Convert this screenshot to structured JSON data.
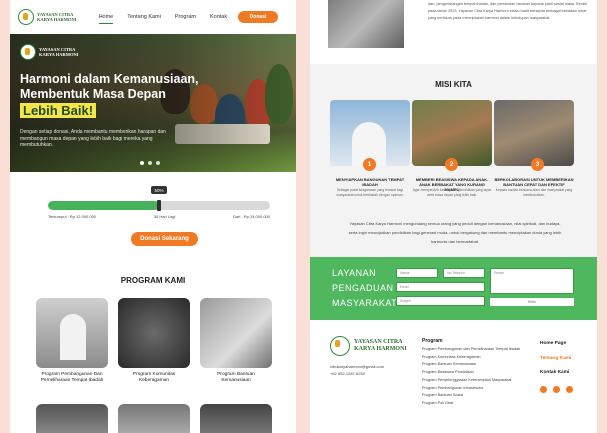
{
  "nav": {
    "logo_line1": "YAYASAN CITRA",
    "logo_line2": "KARYA HARMONI",
    "items": [
      "Home",
      "Tentang Kami",
      "Program",
      "Kontak"
    ],
    "donate_label": "Donasi"
  },
  "hero": {
    "logo_line1": "YAYASAN CITRA",
    "logo_line2": "KARYA HARMONI",
    "title_line1": "Harmoni dalam Kemanusiaan,",
    "title_line2": "Membentuk Masa Depan",
    "highlight": "Lebih Baik!",
    "description": "Dengan setiap donasi, Anda membantu memberikan harapan dan membangun masa depan yang lebih baik bagi mereka yang membutuhkan.",
    "slides": 3,
    "active_slide": 0
  },
  "progress": {
    "percent_label": "50%",
    "fraction": 0.5,
    "collected": "Terkumpul : Rp 12.000.000",
    "days_left": "30 Hari Lagi",
    "target": "Dari : Rp 24.000.000"
  },
  "cta_label": "Donasi Sekarang",
  "programs": {
    "title": "PROGRAM KAMI",
    "items": [
      {
        "line1": "Program Pembangunan Dan",
        "line2": "Pemeliharaan Tempat Ibadah"
      },
      {
        "line1": "Program Komunitas",
        "line2": "Keberagaman"
      },
      {
        "line1": "Program Bantuan",
        "line2": "Kemanusiaan"
      }
    ]
  },
  "about_snippet": "dan, pengembangan tempat ibadah, dan pemberian bantuan kepada panti sosial maka. Berdiri pada tahun 2023, Yayasan Citra Karya Harmoni selalu hadir bersama berbagai kebaikan umat yang berfokus pada menciptakan harmoni dalam kehidupan masyarakat.",
  "misi": {
    "title": "MISI KITA",
    "items": [
      {
        "num": "1",
        "head": "MENYIAPKAN BANGUNAN TEMPAT IBADAH",
        "desc": "Sebagai pusat keagamaan yang terawat bagi masyarakat untuk beribadah dengan nyaman."
      },
      {
        "num": "2",
        "head": "MEMBERI BEASISWA KEPADA ANAK-ANAK BERBAKAT YANG KURANG MAMPU",
        "desc": "Agar memperoleh kesempatan pendidikan yang layak demi masa depan yang lebih baik."
      },
      {
        "num": "3",
        "head": "BERKOLABORASI UNTUK MEMBERIKAN BANTUAN CEPAT DAN EFEKTIF",
        "desc": "Kepada korban bencana alam dan masyarakat yang membutuhkan."
      }
    ],
    "paragraph": "Yayasan Citra Karya Harmoni mengundang semua orang yang peduli dengan kemanusiaan, nilai spiritual, dan budaya, serta ingin mewujudkan pendidikan bagi generasi muda, untuk bergabung dan membantu menciptakan dunia yang lebih harmonis dan bermartabat."
  },
  "contact": {
    "title_line1": "LAYANAN",
    "title_line2": "PENGADUAN",
    "title_line3": "MASYARAKAT",
    "field_name": "Nama",
    "field_phone": "No Telepon",
    "field_email": "Email",
    "field_subject": "Subjek",
    "field_message": "Pesan",
    "submit": "Kirim"
  },
  "footer": {
    "name_line1": "YAYASAN CITRA",
    "name_line2": "KARYA HARMONI",
    "email": "citrokaryaharmoni@gmail.com",
    "phone": "+62 852-1287-6250",
    "program_heading": "Program",
    "program_list": [
      "Program Pembangunan dan Pemeliharaan Tempat Ibadah",
      "Program Komunitas Keberagaman",
      "Program Bantuan Kemanusiaan",
      "Program Beasiswa Pendidikan",
      "Program Penyelenggaraan Keterampilan Masyarakat",
      "Program Pembangunan Infrastruktur",
      "Program Bantuan Sosial",
      "Program Poli Obat"
    ],
    "links": [
      "Home Page",
      "Tentang Kami",
      "Kontak Kami"
    ],
    "accent_color": "#f07a23",
    "brand_green": "#4fb85f"
  }
}
